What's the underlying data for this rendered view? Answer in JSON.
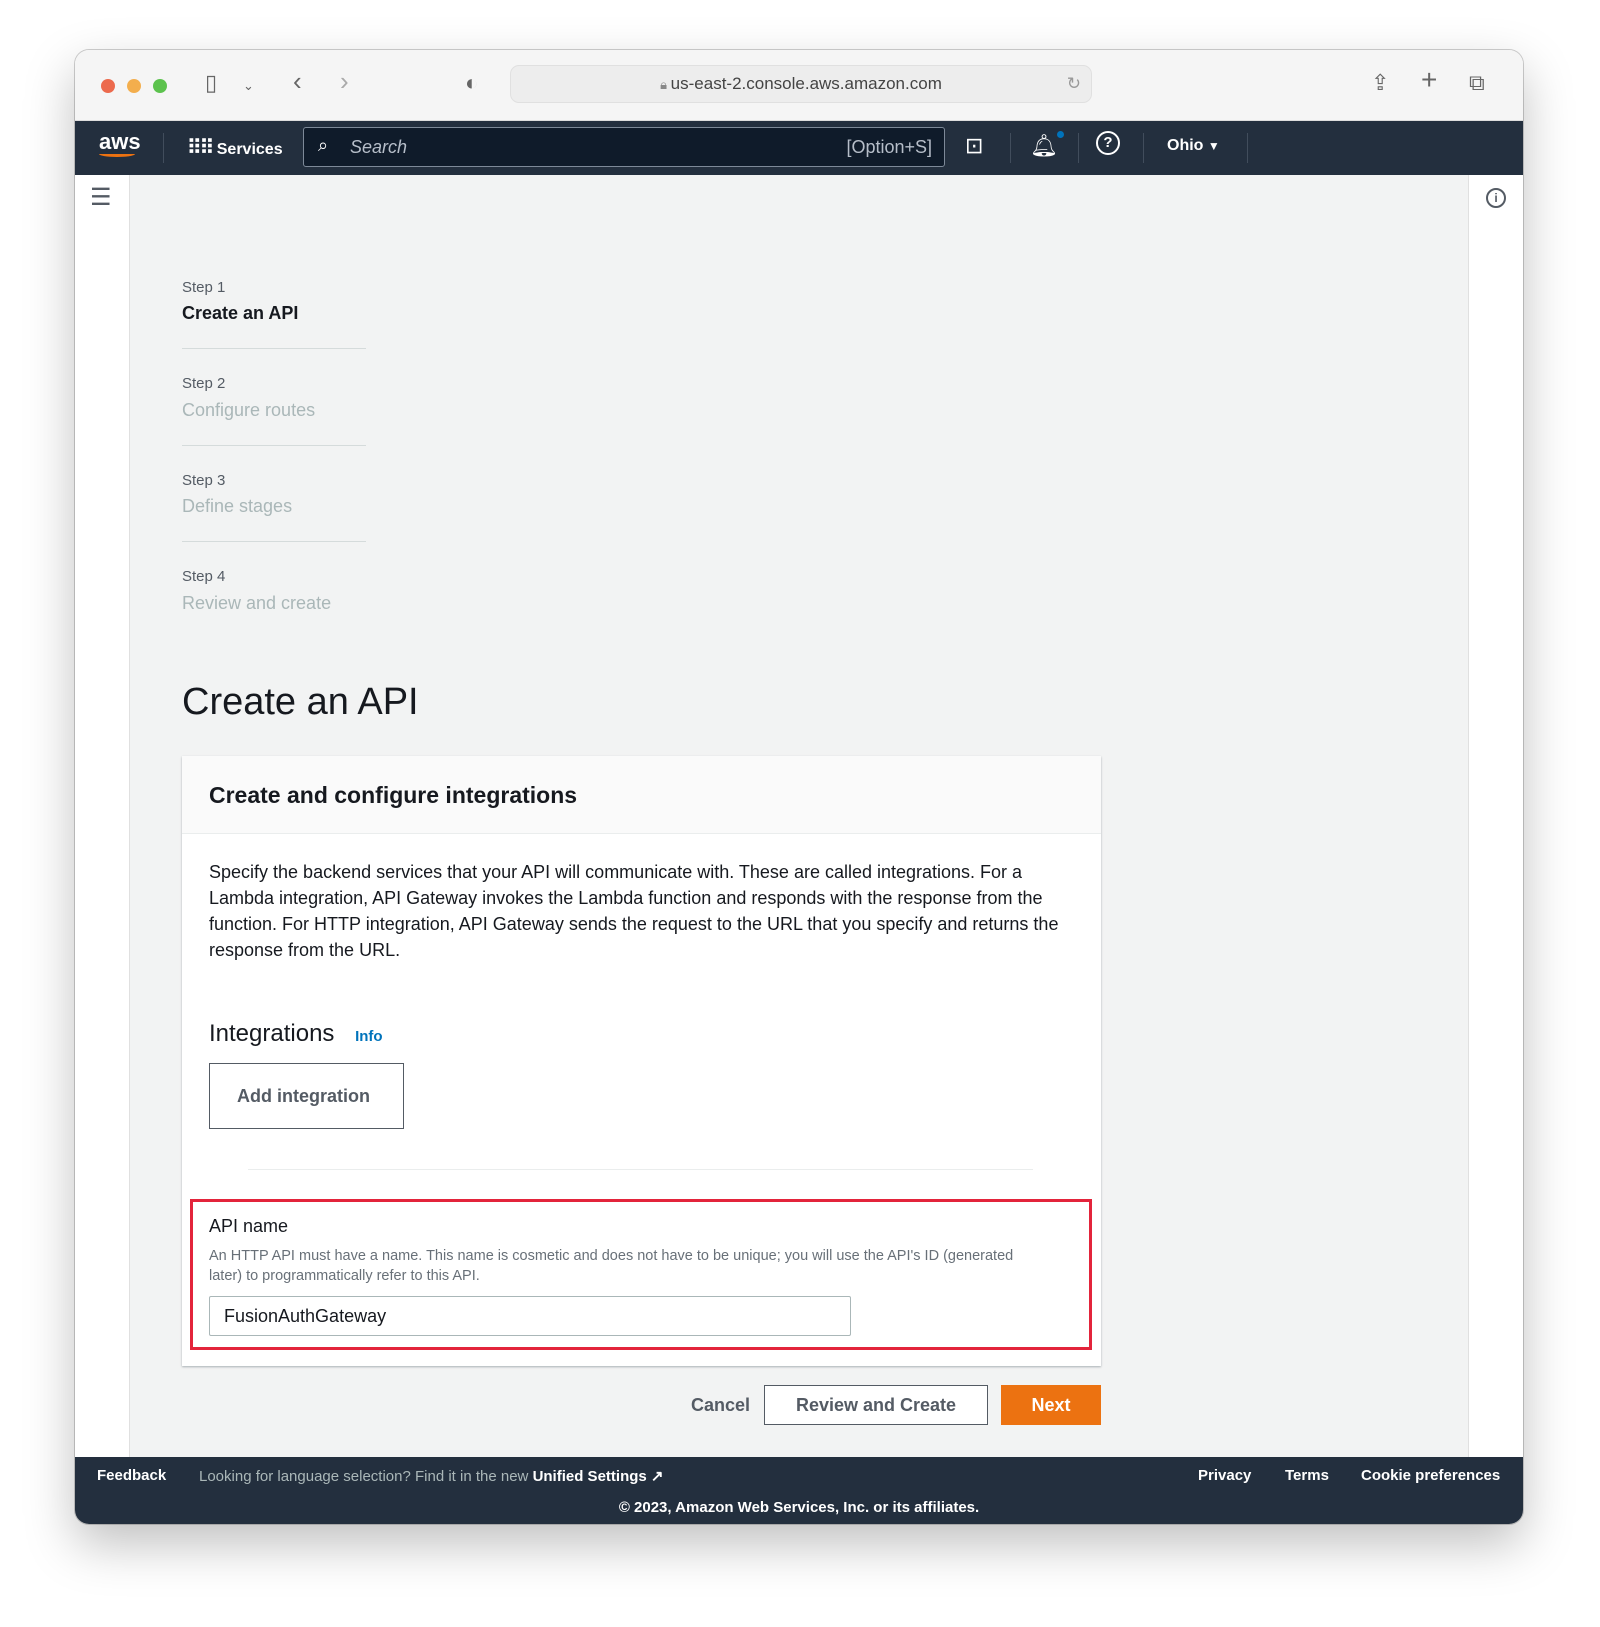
{
  "browser": {
    "url": "us-east-2.console.aws.amazon.com"
  },
  "nav": {
    "logo": "aws",
    "services": "Services",
    "search_placeholder": "Search",
    "search_shortcut": "[Option+S]",
    "region": "Ohio"
  },
  "steps": [
    {
      "label": "Step 1",
      "title": "Create an API",
      "active": true
    },
    {
      "label": "Step 2",
      "title": "Configure routes",
      "active": false
    },
    {
      "label": "Step 3",
      "title": "Define stages",
      "active": false
    },
    {
      "label": "Step 4",
      "title": "Review and create",
      "active": false
    }
  ],
  "page_title": "Create an API",
  "panel": {
    "title": "Create and configure integrations",
    "description": "Specify the backend services that your API will communicate with. These are called integrations. For a Lambda integration, API Gateway invokes the Lambda function and responds with the response from the function. For HTTP integration, API Gateway sends the request to the URL that you specify and returns the response from the URL.",
    "integrations_heading": "Integrations",
    "info": "Info",
    "add_integration": "Add integration",
    "api_name_label": "API name",
    "api_name_help": "An HTTP API must have a name. This name is cosmetic and does not have to be unique; you will use the API's ID (generated later) to programmatically refer to this API.",
    "api_name_value": "FusionAuthGateway"
  },
  "actions": {
    "cancel": "Cancel",
    "review": "Review and Create",
    "next": "Next"
  },
  "footer": {
    "feedback": "Feedback",
    "language_prompt": "Looking for language selection? Find it in the new",
    "unified_settings": "Unified Settings",
    "privacy": "Privacy",
    "terms": "Terms",
    "cookies": "Cookie preferences",
    "copyright": "© 2023, Amazon Web Services, Inc. or its affiliates."
  },
  "colors": {
    "accent": "#ec7211",
    "nav": "#232f3e",
    "highlight": "#e3243b",
    "link": "#0073bb"
  }
}
